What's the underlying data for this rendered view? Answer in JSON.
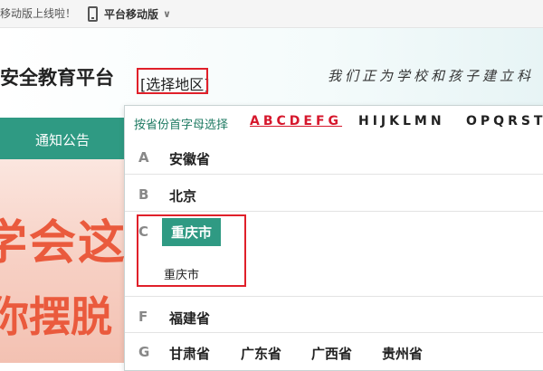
{
  "topbar": {
    "notice": "移动版上线啦！",
    "mobile_label": "平台移动版",
    "chevron": "∨"
  },
  "header": {
    "site_title": "安全教育平台",
    "region_button": "[选择地区]",
    "slogan": "我们正为学校和孩子建立科"
  },
  "nav": {
    "items": [
      "通知公告"
    ]
  },
  "banner": {
    "line1": "学会这",
    "line2": "你摆脱"
  },
  "region_picker": {
    "by_initial_label": "按省份首字母选择",
    "tabs": [
      "ABCDEFG",
      "HIJKLMN",
      "OPQRST"
    ],
    "active_tab": "ABCDEFG",
    "groups": [
      {
        "letter": "A",
        "provinces": [
          "安徽省"
        ]
      },
      {
        "letter": "B",
        "provinces": [
          "北京"
        ]
      },
      {
        "letter": "C",
        "provinces": [
          "重庆市"
        ],
        "expanded": {
          "province": "重庆市",
          "cities": [
            "重庆市"
          ]
        }
      },
      {
        "letter": "F",
        "provinces": [
          "福建省"
        ]
      },
      {
        "letter": "G",
        "provinces": [
          "甘肃省",
          "广东省",
          "广西省",
          "贵州省"
        ]
      }
    ]
  },
  "colors": {
    "primary_green": "#2f9a83",
    "highlight_red": "#e0202a",
    "active_tab_red": "#d6172c"
  },
  "icons": {
    "mobile": "phone-icon",
    "dropdown": "chevron-down-icon"
  }
}
